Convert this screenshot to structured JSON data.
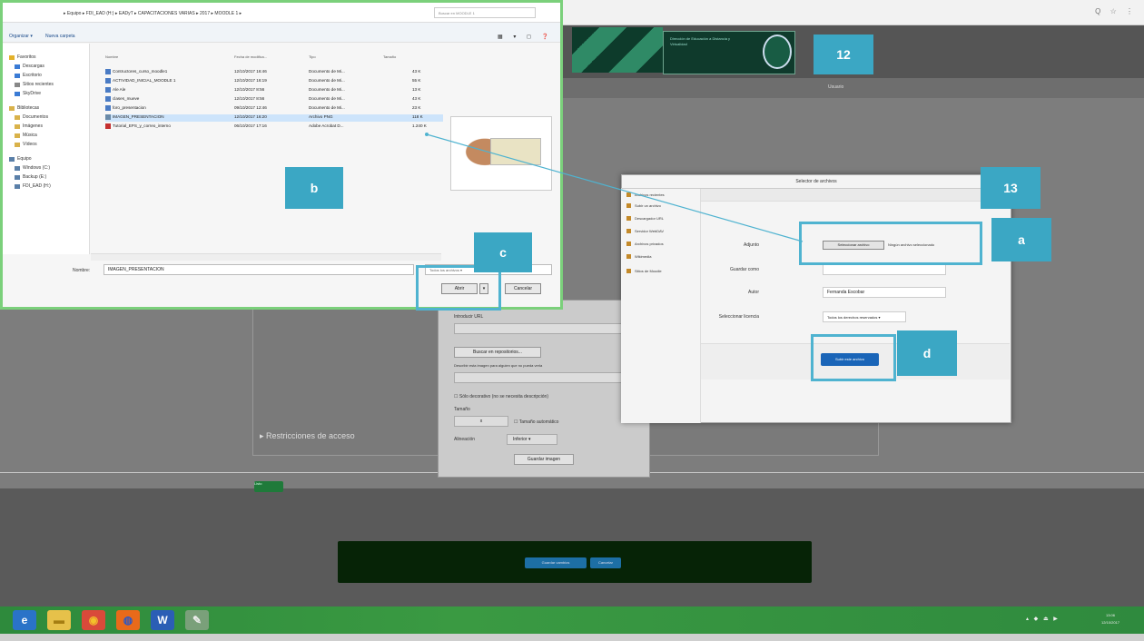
{
  "browser": {
    "controls": "Q ☆ ⋮"
  },
  "moodle": {
    "banner_text": "Dirección de Educación a Distancia y Virtualidad",
    "user_label": "Usuario",
    "access_restrictions": "Restricciones de acceso",
    "green_button": "Listo",
    "save_return": "Guardar cambios",
    "cancel": "Cancelar"
  },
  "image_dialog": {
    "url_label": "Introducir URL",
    "search_repos": "Buscar en repositorios...",
    "describe_label": "Describir esta imagen para alguien que no pueda verla",
    "decorative": "Sólo decorativo (no se necesita descripción)",
    "size_label": "Tamaño",
    "width": "x",
    "auto_size": "Tamaño automático",
    "align_label": "Alineación",
    "align_value": "Inferior",
    "save_image": "Guardar imagen"
  },
  "file_picker": {
    "title": "Selector de archivos",
    "repos": [
      "Archivos recientes",
      "Subir un archivo",
      "Descargador URL",
      "Servidor WebDAV",
      "Archivos privados",
      "Wikimedia",
      "Sitios de Moodle"
    ],
    "attach_label": "Adjunto",
    "choose_file": "Seleccionar archivo",
    "no_file": "Ningún archivo seleccionado",
    "save_as_label": "Guardar como",
    "author_label": "Autor",
    "author_value": "Fernanda Escobar",
    "license_label": "Seleccionar licencia",
    "license_value": "Todos los derechos reservados",
    "upload_button": "Subir este archivo"
  },
  "explorer": {
    "path": "▸ Equipo ▸ FDI_EAD (H:) ▸ EADyT ▸ CAPACITACIONES VARIAS ▸ 2017 ▸ MOODLE 1 ▸",
    "search_placeholder": "Buscar en MOODLE 1",
    "organize": "Organizar ▾",
    "new_folder": "Nueva carpeta",
    "view_icons": "▦ ▾ ◻ ❓",
    "nav": [
      {
        "label": "Favoritos",
        "color": "#e3b12a"
      },
      {
        "label": "Descargas",
        "color": "#3a7bd5"
      },
      {
        "label": "Escritorio",
        "color": "#3a7bd5"
      },
      {
        "label": "Sitios recientes",
        "color": "#888"
      },
      {
        "label": "SkyDrive",
        "color": "#3a7bd5"
      },
      {
        "label": "Bibliotecas",
        "color": "#d9b24a"
      },
      {
        "label": "Documentos",
        "color": "#d9b24a"
      },
      {
        "label": "Imágenes",
        "color": "#d9b24a"
      },
      {
        "label": "Música",
        "color": "#d9b24a"
      },
      {
        "label": "Vídeos",
        "color": "#d9b24a"
      },
      {
        "label": "Equipo",
        "color": "#5a7fa8"
      },
      {
        "label": "Windows (C:)",
        "color": "#5a7fa8"
      },
      {
        "label": "Backup (E:)",
        "color": "#5a7fa8"
      },
      {
        "label": "FDI_EAD (H:)",
        "color": "#5a7fa8"
      }
    ],
    "columns": [
      "Nombre",
      "Fecha de modifica...",
      "Tipo",
      "Tamaño"
    ],
    "files": [
      {
        "name": "Contructores_curso_moodle1",
        "date": "12/10/2017 16:46",
        "type": "Documento de Mi...",
        "size": "43 K",
        "icon": "doc"
      },
      {
        "name": "ACTIVIDAD_INICIAL_MOODLE 1",
        "date": "12/10/2017 16:19",
        "type": "Documento de Mi...",
        "size": "55 K",
        "icon": "doc"
      },
      {
        "name": "Ale Ale",
        "date": "12/10/2017 8:56",
        "type": "Documento de Mi...",
        "size": "13 K",
        "icon": "doc"
      },
      {
        "name": "clases_mueve",
        "date": "12/10/2017 8:56",
        "type": "Documento de Mi...",
        "size": "43 K",
        "icon": "doc"
      },
      {
        "name": "foro_presentacion",
        "date": "09/10/2017 12:46",
        "type": "Documento de Mi...",
        "size": "23 K",
        "icon": "doc"
      },
      {
        "name": "IMAGEN_PRESENTACION",
        "date": "12/10/2017 16:20",
        "type": "Archivo PNG",
        "size": "118 K",
        "icon": "png",
        "selected": true
      },
      {
        "name": "Tutorial_EPS_y_correo_interno",
        "date": "06/10/2017 17:16",
        "type": "Adobe Acrobat D...",
        "size": "1.240 K",
        "icon": "pdf"
      }
    ],
    "name_label": "Nombre:",
    "name_value": "IMAGEN_PRESENTACION",
    "filter": "Todos los archivos",
    "open": "Abrir",
    "open_arrow": "▾",
    "cancel": "Cancelar"
  },
  "annotations": {
    "n12": "12",
    "n13": "13",
    "a": "a",
    "b": "b",
    "c": "c",
    "d": "d"
  },
  "taskbar": {
    "apps": [
      {
        "label": "e",
        "bg": "#2a73c8",
        "fg": "#fff"
      },
      {
        "label": "▬",
        "bg": "#e6c14a",
        "fg": "#a57e12"
      },
      {
        "label": "◉",
        "bg": "#d94a3a",
        "fg": "#f3c12a"
      },
      {
        "label": "◍",
        "bg": "#e86a1a",
        "fg": "#2d58c4"
      },
      {
        "label": "W",
        "bg": "#2b5eb5",
        "fg": "#fff"
      },
      {
        "label": "✎",
        "bg": "#7aa07a",
        "fg": "#eee"
      }
    ],
    "tray": "▴ ◆ ⏏ ▶",
    "time": "13:06",
    "date": "12/10/2017"
  }
}
